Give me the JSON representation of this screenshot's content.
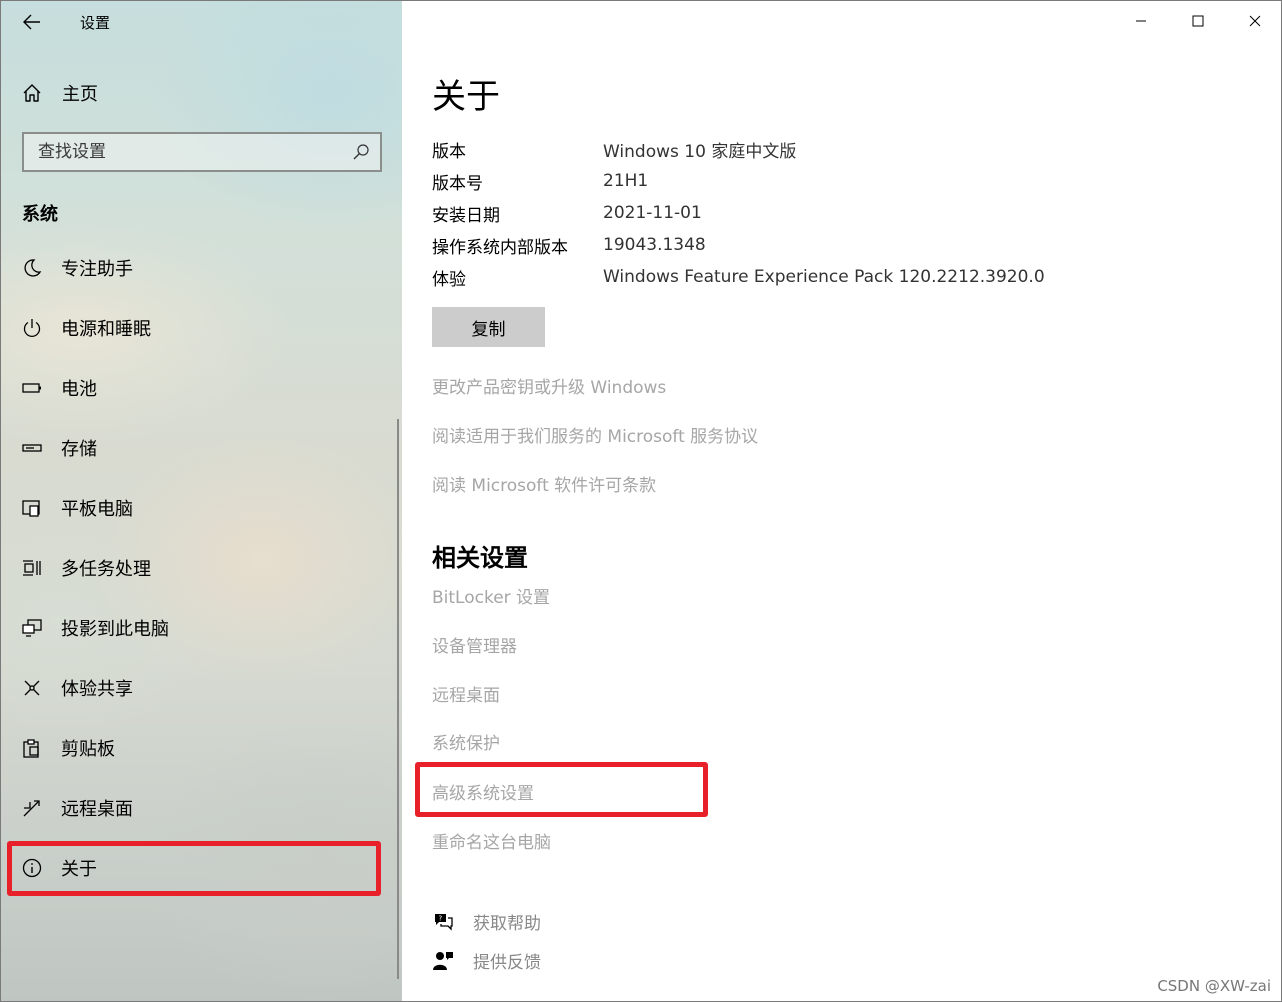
{
  "window": {
    "title": "设置"
  },
  "sidebar": {
    "home_label": "主页",
    "search_placeholder": "查找设置",
    "section_title": "系统",
    "items": [
      {
        "label": "专注助手",
        "icon": "moon-icon"
      },
      {
        "label": "电源和睡眠",
        "icon": "power-icon"
      },
      {
        "label": "电池",
        "icon": "battery-icon"
      },
      {
        "label": "存储",
        "icon": "storage-icon"
      },
      {
        "label": "平板电脑",
        "icon": "tablet-icon"
      },
      {
        "label": "多任务处理",
        "icon": "multitasking-icon"
      },
      {
        "label": "投影到此电脑",
        "icon": "project-icon"
      },
      {
        "label": "体验共享",
        "icon": "share-icon"
      },
      {
        "label": "剪贴板",
        "icon": "clipboard-icon"
      },
      {
        "label": "远程桌面",
        "icon": "remote-desktop-icon"
      },
      {
        "label": "关于",
        "icon": "info-icon",
        "selected": true
      }
    ]
  },
  "main": {
    "title": "关于",
    "specs": [
      {
        "key": "版本",
        "value": "Windows 10 家庭中文版"
      },
      {
        "key": "版本号",
        "value": "21H1"
      },
      {
        "key": "安装日期",
        "value": "2021-11-01"
      },
      {
        "key": "操作系统内部版本",
        "value": "19043.1348"
      },
      {
        "key": "体验",
        "value": "Windows Feature Experience Pack 120.2212.3920.0"
      }
    ],
    "copy_label": "复制",
    "links": [
      "更改产品密钥或升级 Windows",
      "阅读适用于我们服务的 Microsoft 服务协议",
      "阅读 Microsoft 软件许可条款"
    ],
    "related_title": "相关设置",
    "related_links": [
      "BitLocker 设置",
      "设备管理器",
      "远程桌面",
      "系统保护",
      "高级系统设置",
      "重命名这台电脑"
    ],
    "help": [
      {
        "label": "获取帮助",
        "icon": "help-chat-icon"
      },
      {
        "label": "提供反馈",
        "icon": "feedback-icon"
      }
    ]
  },
  "colors": {
    "highlight": "#e8202a",
    "link_disabled": "#a6a6a6",
    "button_bg": "#cccccc"
  },
  "watermark": "CSDN @XW-zai"
}
